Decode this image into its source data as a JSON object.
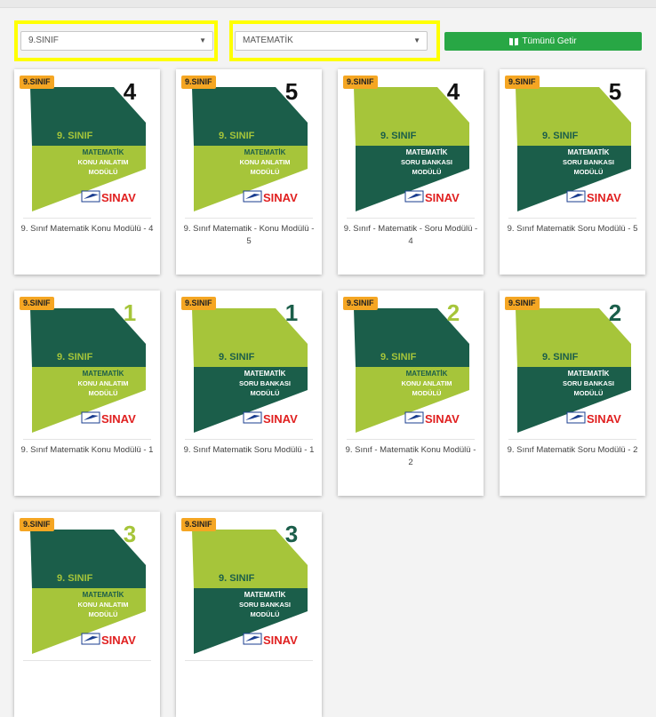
{
  "filters": {
    "class_select": "9.SINIF",
    "subject_select": "MATEMATİK",
    "fetch_all_label": "Tümünü Getir"
  },
  "cover_text": {
    "grade": "9. SINIF",
    "subject": "MATEMATİK",
    "konu_line1": "KONU ANLATIM",
    "soru_line1": "SORU BANKASI",
    "line2": "MODÜLÜ",
    "brand": "SINAV"
  },
  "colors": {
    "dark_green": "#1b5e4a",
    "light_green": "#a6c53a",
    "badge": "#f5a623",
    "button": "#28a745",
    "highlight": "#ffff00",
    "brand_red": "#e02020"
  },
  "cards": [
    {
      "badge": "9.SINIF",
      "number": "4",
      "type": "konu",
      "title": "9. Sınıf Matematik Konu Modülü - 4"
    },
    {
      "badge": "9.SINIF",
      "number": "5",
      "type": "konu",
      "title": "9. Sınıf Matematik - Konu Modülü - 5"
    },
    {
      "badge": "9.SINIF",
      "number": "4",
      "type": "soru",
      "title": "9. Sınıf - Matematik - Soru Modülü - 4"
    },
    {
      "badge": "9.SINIF",
      "number": "5",
      "type": "soru",
      "title": "9. Sınıf Matematik Soru Modülü - 5"
    },
    {
      "badge": "9.SINIF",
      "number": "1",
      "type": "konu",
      "title": "9. Sınıf Matematik Konu Modülü - 1"
    },
    {
      "badge": "9.SINIF",
      "number": "1",
      "type": "soru",
      "title": "9. Sınıf Matematik Soru Modülü - 1"
    },
    {
      "badge": "9.SINIF",
      "number": "2",
      "type": "konu",
      "title": "9. Sınıf - Matematik Konu Modülü - 2"
    },
    {
      "badge": "9.SINIF",
      "number": "2",
      "type": "soru",
      "title": "9. Sınıf Matematik Soru Modülü - 2"
    },
    {
      "badge": "9.SINIF",
      "number": "3",
      "type": "konu",
      "title": ""
    },
    {
      "badge": "9.SINIF",
      "number": "3",
      "type": "soru",
      "title": ""
    }
  ]
}
